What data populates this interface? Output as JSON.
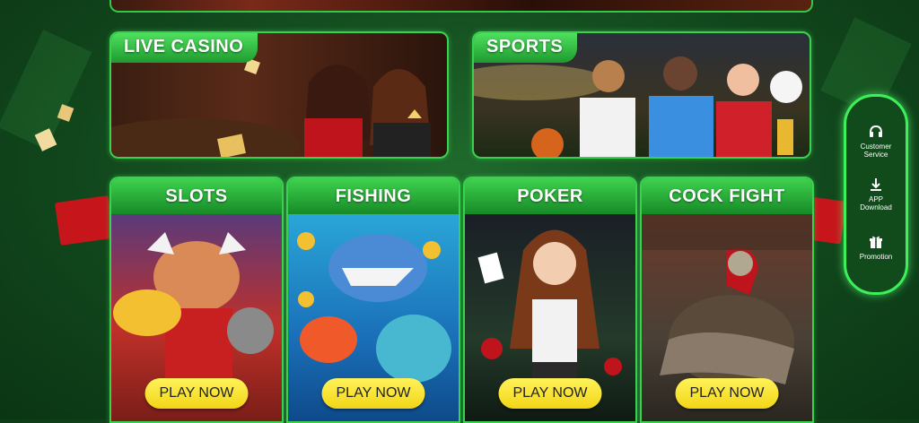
{
  "banners": {
    "live_casino": "LIVE CASINO",
    "sports": "SPORTS"
  },
  "games": [
    {
      "title": "SLOTS",
      "button": "PLAY NOW"
    },
    {
      "title": "FISHING",
      "button": "PLAY NOW"
    },
    {
      "title": "POKER",
      "button": "PLAY NOW"
    },
    {
      "title": "COCK FIGHT",
      "button": "PLAY NOW"
    }
  ],
  "sidebar": {
    "customer_service": [
      "Customer",
      "Service"
    ],
    "app_download": [
      "APP",
      "Download"
    ],
    "promotion": "Promotion"
  },
  "colors": {
    "accent": "#3ad14f",
    "button": "#f2d516",
    "background": "#11461c"
  }
}
